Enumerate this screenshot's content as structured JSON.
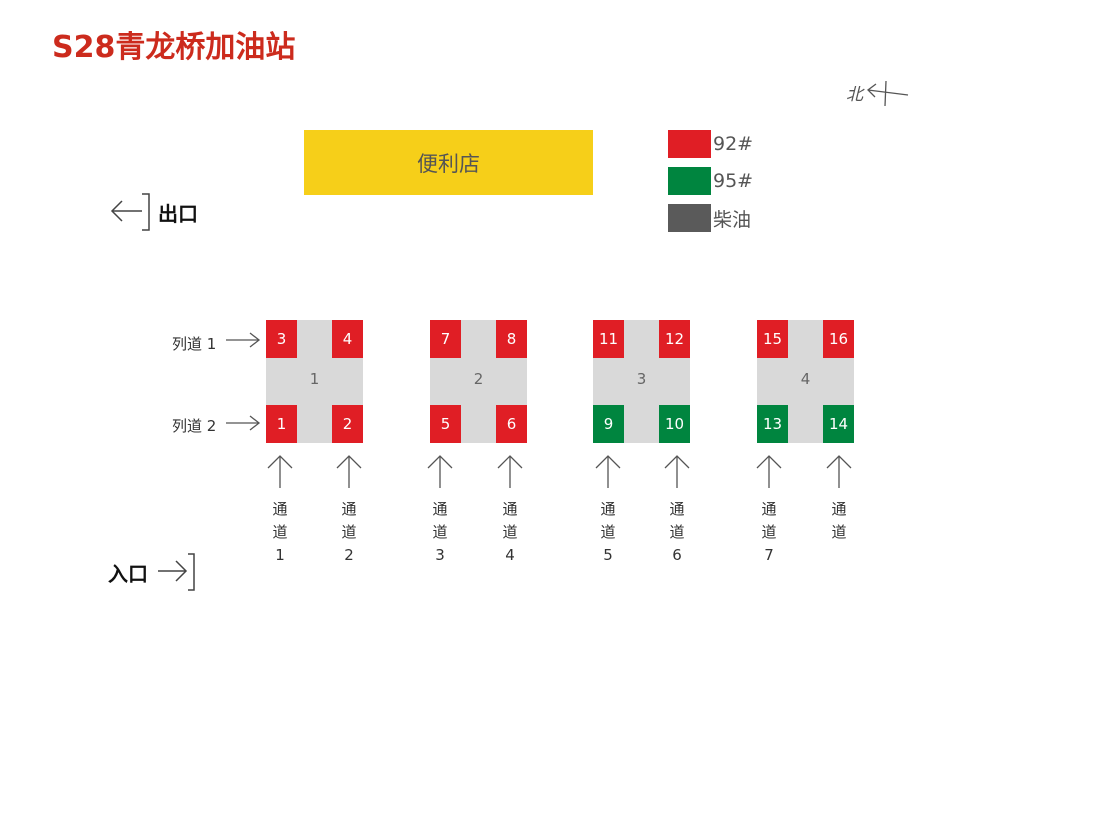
{
  "title": "S28青龙桥加油站",
  "compass": {
    "label": "北"
  },
  "store": {
    "label": "便利店",
    "color": "#f6cf19"
  },
  "legend": [
    {
      "color": "#e01e25",
      "label": "92#"
    },
    {
      "color": "#00853f",
      "label": "95#"
    },
    {
      "color": "#5a5a5a",
      "label": "柴油"
    }
  ],
  "exit_label": "出口",
  "entry_label": "入口",
  "lanes": [
    {
      "label": "列道 1"
    },
    {
      "label": "列道 2"
    }
  ],
  "colors": {
    "92": "#e01e25",
    "95": "#00853f",
    "island": "#d9d9d9"
  },
  "islands": [
    {
      "number": "1",
      "pumps": [
        {
          "n": "3",
          "fuel": "92"
        },
        {
          "n": "4",
          "fuel": "92"
        },
        {
          "n": "1",
          "fuel": "92"
        },
        {
          "n": "2",
          "fuel": "92"
        }
      ]
    },
    {
      "number": "2",
      "pumps": [
        {
          "n": "7",
          "fuel": "92"
        },
        {
          "n": "8",
          "fuel": "92"
        },
        {
          "n": "5",
          "fuel": "92"
        },
        {
          "n": "6",
          "fuel": "92"
        }
      ]
    },
    {
      "number": "3",
      "pumps": [
        {
          "n": "11",
          "fuel": "92"
        },
        {
          "n": "12",
          "fuel": "92"
        },
        {
          "n": "9",
          "fuel": "95"
        },
        {
          "n": "10",
          "fuel": "95"
        }
      ]
    },
    {
      "number": "4",
      "pumps": [
        {
          "n": "15",
          "fuel": "92"
        },
        {
          "n": "16",
          "fuel": "92"
        },
        {
          "n": "13",
          "fuel": "95"
        },
        {
          "n": "14",
          "fuel": "95"
        }
      ]
    }
  ],
  "channels": [
    {
      "chars": [
        "通",
        "道",
        "1"
      ]
    },
    {
      "chars": [
        "通",
        "道",
        "2"
      ]
    },
    {
      "chars": [
        "通",
        "道",
        "3"
      ]
    },
    {
      "chars": [
        "通",
        "道",
        "4"
      ]
    },
    {
      "chars": [
        "通",
        "道",
        "5"
      ]
    },
    {
      "chars": [
        "通",
        "道",
        "6"
      ]
    },
    {
      "chars": [
        "通",
        "道",
        "7"
      ]
    },
    {
      "chars": [
        "通",
        "道"
      ]
    }
  ]
}
